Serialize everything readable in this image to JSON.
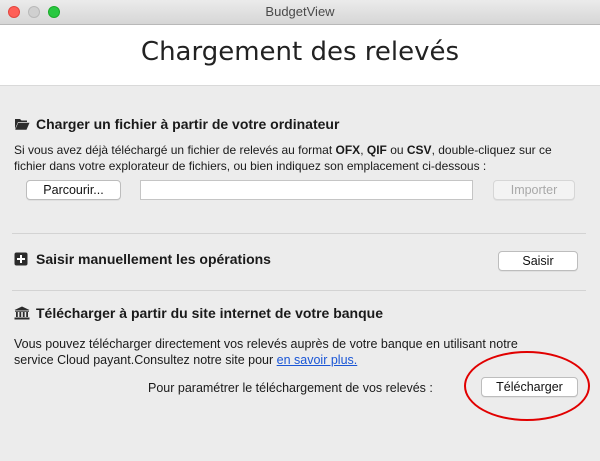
{
  "window": {
    "title": "BudgetView"
  },
  "header": {
    "title": "Chargement des relevés"
  },
  "file_section": {
    "title": "Charger un fichier à partir de votre ordinateur",
    "desc_a": "Si vous avez déjà téléchargé un fichier de relevés au format ",
    "fmt_ofx": "OFX",
    "sep1": ", ",
    "fmt_qif": "QIF",
    "sep2": " ou ",
    "fmt_csv": "CSV",
    "desc_b": ", double-cliquez sur ce",
    "desc_line2": "fichier dans votre explorateur de fichiers, ou bien indiquez son emplacement ci-dessous :",
    "browse_label": "Parcourir...",
    "path_value": "",
    "import_label": "Importer"
  },
  "manual_section": {
    "title": "Saisir manuellement les opérations",
    "button_label": "Saisir"
  },
  "bank_section": {
    "title": "Télécharger à partir du site internet de votre banque",
    "desc_line1": "Vous pouvez télécharger directement vos relevés auprès de votre banque en utilisant notre",
    "desc_line2_a": "service Cloud payant.Consultez notre site pour ",
    "link_label": "en savoir plus.",
    "prompt": "Pour paramétrer le téléchargement de vos relevés :",
    "download_label": "Télécharger"
  },
  "colors": {
    "annotation": "#e10000",
    "link": "#1a56d6"
  }
}
